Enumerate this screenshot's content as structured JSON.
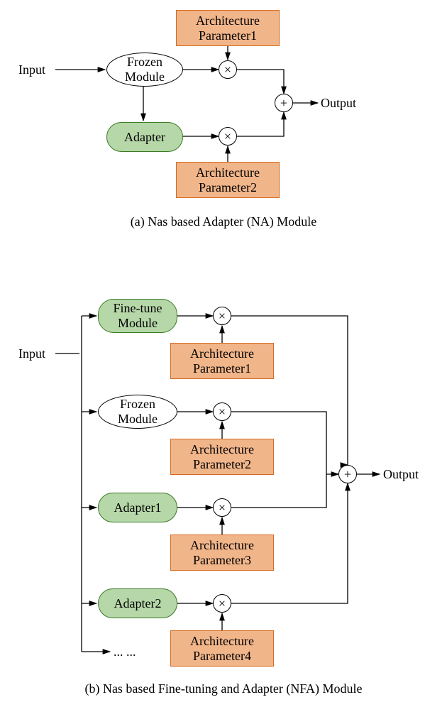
{
  "diagram_a": {
    "input": "Input",
    "output": "Output",
    "frozen": "Frozen\nModule",
    "adapter": "Adapter",
    "param1": "Architecture\nParameter1",
    "param2": "Architecture\nParameter2",
    "op_mul": "×",
    "op_add": "+",
    "caption": "(a) Nas based Adapter (NA) Module"
  },
  "diagram_b": {
    "input": "Input",
    "output": "Output",
    "finetune": "Fine-tune\nModule",
    "frozen": "Frozen\nModule",
    "adapter1": "Adapter1",
    "adapter2": "Adapter2",
    "param1": "Architecture\nParameter1",
    "param2": "Architecture\nParameter2",
    "param3": "Architecture\nParameter3",
    "param4": "Architecture\nParameter4",
    "op_mul": "×",
    "op_add": "+",
    "dots": "...  ...",
    "caption": "(b) Nas based Fine-tuning and Adapter (NFA) Module"
  }
}
